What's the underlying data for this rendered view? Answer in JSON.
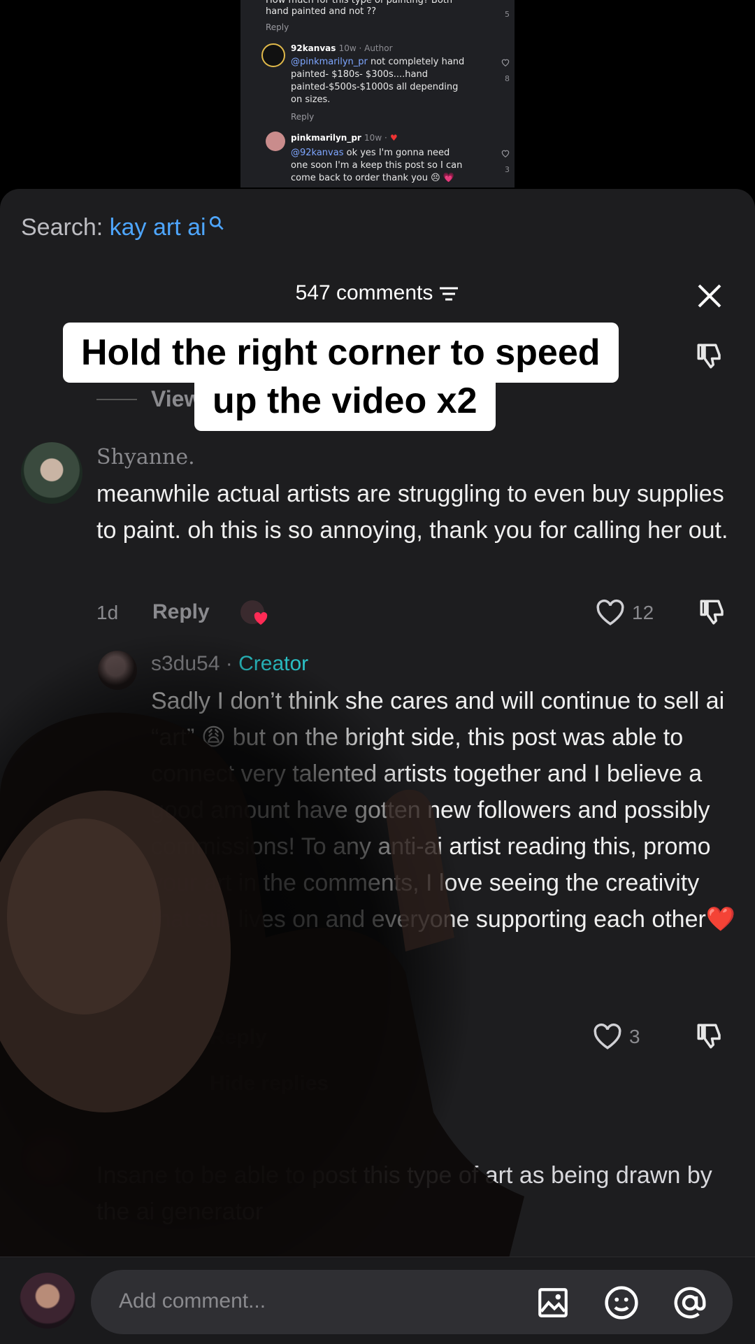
{
  "embed": {
    "line0": "How much for this type of painting? Both",
    "line1": "hand painted and not ??",
    "reply1": "Reply",
    "count1": "5",
    "c2_user": "92kanvas",
    "c2_meta": "10w · Author",
    "c2_mention": "@pinkmarilyn_pr",
    "c2_line1": " not completely hand",
    "c2_line2": "painted- $180s- $300s....hand",
    "c2_line3": "painted-$500s-$1000s all depending",
    "c2_line4": "on sizes.",
    "c2_reply": "Reply",
    "c2_count": "8",
    "c3_user": "pinkmarilyn_pr",
    "c3_meta": "10w ·",
    "c3_mention": "@92kanvas",
    "c3_line1": " ok yes I'm gonna need",
    "c3_line2": "one soon I'm a keep this post so I can",
    "c3_line3": "come back to order thank you 😣 💗",
    "c3_count": "3"
  },
  "search": {
    "prefix": "Search:",
    "term": "kay art ai"
  },
  "header": {
    "count": "547 comments"
  },
  "caption": {
    "line1": "Hold the right corner to speed",
    "line2": "up the video x2"
  },
  "view_replies": "View",
  "comment1": {
    "user": "Shyanne.",
    "text": "meanwhile actual artists are struggling to even buy supplies to paint. oh this is so annoying, thank you for calling her out.",
    "age": "1d",
    "reply": "Reply",
    "likes": "12"
  },
  "comment2": {
    "user": "s3du54",
    "sep": " · ",
    "badge": "Creator",
    "text": "Sadly I don’t think she cares and will continue to sell ai “art” 😩 but on the bright side, this post was able to connect very talented artists together and I believe a good amount have gotten new followers and possibly commissions! To any anti-ai artist reading this, promo your art in the comments, I love seeing the creativity that still lives on and everyone supporting each other❤️",
    "reply": "Reply",
    "likes": "3",
    "hide": "Hide replies"
  },
  "comment3": {
    "text": "Insane to be able to post this type of art as being drawn by the ai generator"
  },
  "composer": {
    "placeholder": "Add comment..."
  },
  "colors": {
    "accent_blue": "#4ea6ff",
    "creator_teal": "#2bc4c9",
    "sheet_bg": "#1d1d1f"
  }
}
